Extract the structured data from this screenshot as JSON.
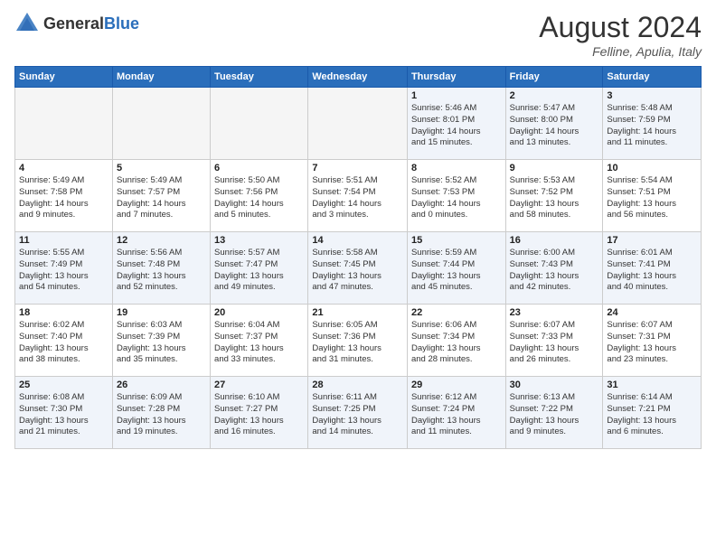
{
  "header": {
    "logo_general": "General",
    "logo_blue": "Blue",
    "month_year": "August 2024",
    "location": "Felline, Apulia, Italy"
  },
  "weekdays": [
    "Sunday",
    "Monday",
    "Tuesday",
    "Wednesday",
    "Thursday",
    "Friday",
    "Saturday"
  ],
  "weeks": [
    [
      {
        "day": "",
        "info": ""
      },
      {
        "day": "",
        "info": ""
      },
      {
        "day": "",
        "info": ""
      },
      {
        "day": "",
        "info": ""
      },
      {
        "day": "1",
        "info": "Sunrise: 5:46 AM\nSunset: 8:01 PM\nDaylight: 14 hours\nand 15 minutes."
      },
      {
        "day": "2",
        "info": "Sunrise: 5:47 AM\nSunset: 8:00 PM\nDaylight: 14 hours\nand 13 minutes."
      },
      {
        "day": "3",
        "info": "Sunrise: 5:48 AM\nSunset: 7:59 PM\nDaylight: 14 hours\nand 11 minutes."
      }
    ],
    [
      {
        "day": "4",
        "info": "Sunrise: 5:49 AM\nSunset: 7:58 PM\nDaylight: 14 hours\nand 9 minutes."
      },
      {
        "day": "5",
        "info": "Sunrise: 5:49 AM\nSunset: 7:57 PM\nDaylight: 14 hours\nand 7 minutes."
      },
      {
        "day": "6",
        "info": "Sunrise: 5:50 AM\nSunset: 7:56 PM\nDaylight: 14 hours\nand 5 minutes."
      },
      {
        "day": "7",
        "info": "Sunrise: 5:51 AM\nSunset: 7:54 PM\nDaylight: 14 hours\nand 3 minutes."
      },
      {
        "day": "8",
        "info": "Sunrise: 5:52 AM\nSunset: 7:53 PM\nDaylight: 14 hours\nand 0 minutes."
      },
      {
        "day": "9",
        "info": "Sunrise: 5:53 AM\nSunset: 7:52 PM\nDaylight: 13 hours\nand 58 minutes."
      },
      {
        "day": "10",
        "info": "Sunrise: 5:54 AM\nSunset: 7:51 PM\nDaylight: 13 hours\nand 56 minutes."
      }
    ],
    [
      {
        "day": "11",
        "info": "Sunrise: 5:55 AM\nSunset: 7:49 PM\nDaylight: 13 hours\nand 54 minutes."
      },
      {
        "day": "12",
        "info": "Sunrise: 5:56 AM\nSunset: 7:48 PM\nDaylight: 13 hours\nand 52 minutes."
      },
      {
        "day": "13",
        "info": "Sunrise: 5:57 AM\nSunset: 7:47 PM\nDaylight: 13 hours\nand 49 minutes."
      },
      {
        "day": "14",
        "info": "Sunrise: 5:58 AM\nSunset: 7:45 PM\nDaylight: 13 hours\nand 47 minutes."
      },
      {
        "day": "15",
        "info": "Sunrise: 5:59 AM\nSunset: 7:44 PM\nDaylight: 13 hours\nand 45 minutes."
      },
      {
        "day": "16",
        "info": "Sunrise: 6:00 AM\nSunset: 7:43 PM\nDaylight: 13 hours\nand 42 minutes."
      },
      {
        "day": "17",
        "info": "Sunrise: 6:01 AM\nSunset: 7:41 PM\nDaylight: 13 hours\nand 40 minutes."
      }
    ],
    [
      {
        "day": "18",
        "info": "Sunrise: 6:02 AM\nSunset: 7:40 PM\nDaylight: 13 hours\nand 38 minutes."
      },
      {
        "day": "19",
        "info": "Sunrise: 6:03 AM\nSunset: 7:39 PM\nDaylight: 13 hours\nand 35 minutes."
      },
      {
        "day": "20",
        "info": "Sunrise: 6:04 AM\nSunset: 7:37 PM\nDaylight: 13 hours\nand 33 minutes."
      },
      {
        "day": "21",
        "info": "Sunrise: 6:05 AM\nSunset: 7:36 PM\nDaylight: 13 hours\nand 31 minutes."
      },
      {
        "day": "22",
        "info": "Sunrise: 6:06 AM\nSunset: 7:34 PM\nDaylight: 13 hours\nand 28 minutes."
      },
      {
        "day": "23",
        "info": "Sunrise: 6:07 AM\nSunset: 7:33 PM\nDaylight: 13 hours\nand 26 minutes."
      },
      {
        "day": "24",
        "info": "Sunrise: 6:07 AM\nSunset: 7:31 PM\nDaylight: 13 hours\nand 23 minutes."
      }
    ],
    [
      {
        "day": "25",
        "info": "Sunrise: 6:08 AM\nSunset: 7:30 PM\nDaylight: 13 hours\nand 21 minutes."
      },
      {
        "day": "26",
        "info": "Sunrise: 6:09 AM\nSunset: 7:28 PM\nDaylight: 13 hours\nand 19 minutes."
      },
      {
        "day": "27",
        "info": "Sunrise: 6:10 AM\nSunset: 7:27 PM\nDaylight: 13 hours\nand 16 minutes."
      },
      {
        "day": "28",
        "info": "Sunrise: 6:11 AM\nSunset: 7:25 PM\nDaylight: 13 hours\nand 14 minutes."
      },
      {
        "day": "29",
        "info": "Sunrise: 6:12 AM\nSunset: 7:24 PM\nDaylight: 13 hours\nand 11 minutes."
      },
      {
        "day": "30",
        "info": "Sunrise: 6:13 AM\nSunset: 7:22 PM\nDaylight: 13 hours\nand 9 minutes."
      },
      {
        "day": "31",
        "info": "Sunrise: 6:14 AM\nSunset: 7:21 PM\nDaylight: 13 hours\nand 6 minutes."
      }
    ]
  ]
}
